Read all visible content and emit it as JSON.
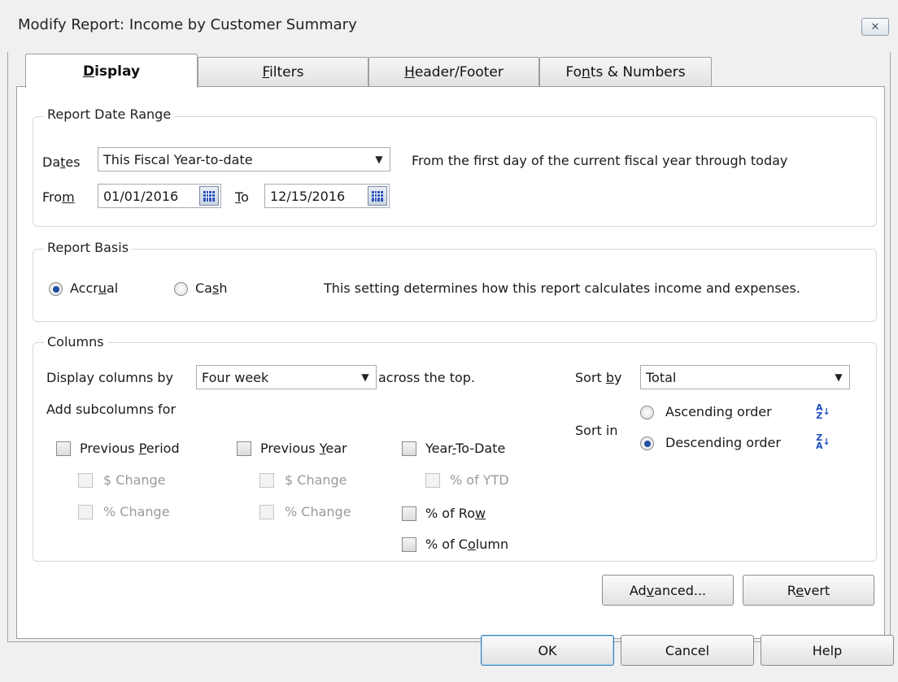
{
  "window": {
    "title": "Modify Report: Income by Customer Summary",
    "close_glyph": "✕"
  },
  "tabs": [
    {
      "label": "Display",
      "hotkey": "D",
      "rest": "isplay",
      "active": true
    },
    {
      "label": "Filters",
      "hotkey": "F",
      "rest": "ilters"
    },
    {
      "label": "Header/Footer",
      "hotkey": "H",
      "rest": "eader/Footer"
    },
    {
      "label": "Fonts & Numbers",
      "pre": "Fo",
      "hotkey": "n",
      "rest": "ts & Numbers"
    }
  ],
  "date_range": {
    "group_label": "Report Date Range",
    "dates_label_pre": "Da",
    "dates_label_hot": "t",
    "dates_label_post": "es",
    "dates_value": "This Fiscal Year-to-date",
    "description": "From the first day of the current fiscal year through today",
    "from_label_pre": "Fro",
    "from_label_hot": "m",
    "from_value": "01/01/2016",
    "to_label_hot": "T",
    "to_label_post": "o",
    "to_value": "12/15/2016"
  },
  "basis": {
    "group_label": "Report Basis",
    "accrual_pre": "Accr",
    "accrual_hot": "u",
    "accrual_post": "al",
    "cash_pre": "Ca",
    "cash_hot": "s",
    "cash_post": "h",
    "selected": "Accrual",
    "description": "This setting determines how this report calculates income and expenses."
  },
  "columns": {
    "group_label": "Columns",
    "display_by_label": "Display columns by",
    "display_by_value": "Four week",
    "across_label": "across the top.",
    "sort_by_pre": "Sort ",
    "sort_by_hot": "b",
    "sort_by_post": "y",
    "sort_by_value": "Total",
    "add_subcolumns_label": "Add subcolumns for",
    "sort_in_label": "Sort in",
    "ascending_pre": "Ascendin",
    "ascending_hot": "g",
    "ascending_post": " order",
    "descending_pre": "Descendin",
    "descending_hot": "g",
    "descending_post": " order",
    "sort_selected": "Descending",
    "prev_period_pre": "Previous ",
    "prev_period_hot": "P",
    "prev_period_post": "eriod",
    "prev_year_pre": "Previous ",
    "prev_year_hot": "Y",
    "prev_year_post": "ear",
    "ytd_pre": "Year",
    "ytd_hot": "-",
    "ytd_post": "To-Date",
    "dollar_change_1": "$ Change",
    "pct_change_1": "% Change",
    "dollar_change_2": "$ Change",
    "pct_change_2": "% Change",
    "pct_ytd": "% of YTD",
    "pct_row_pre": "% of Ro",
    "pct_row_hot": "w",
    "pct_col_pre": "% of C",
    "pct_col_hot": "o",
    "pct_col_post": "lumn",
    "asc_icon_top": "A",
    "asc_icon_bottom": "Z",
    "desc_icon_top": "Z",
    "desc_icon_bottom": "A",
    "sort_arrow": "↓"
  },
  "buttons": {
    "advanced_pre": "Ad",
    "advanced_hot": "v",
    "advanced_post": "anced...",
    "revert_pre": "R",
    "revert_hot": "e",
    "revert_post": "vert",
    "ok": "OK",
    "cancel": "Cancel",
    "help": "Help"
  },
  "icons": {
    "calendar": "calendar-icon",
    "dropdown": "chevron-down-icon",
    "arrow_glyph": "▼"
  }
}
